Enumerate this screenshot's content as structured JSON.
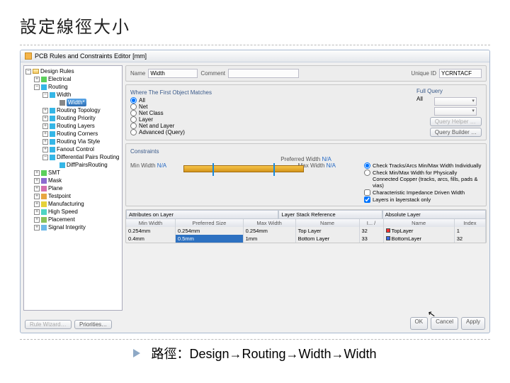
{
  "slide": {
    "title": "設定線徑大小",
    "caption_prefix": "路徑：",
    "caption_path": "Design→Routing→Width→Width"
  },
  "window": {
    "title": "PCB Rules and Constraints Editor [mm]"
  },
  "tree": {
    "root": "Design Rules",
    "items": [
      {
        "label": "Electrical",
        "indent": 12,
        "exp": "+",
        "icon": "electrical"
      },
      {
        "label": "Routing",
        "indent": 12,
        "exp": "−",
        "icon": "routing"
      },
      {
        "label": "Width",
        "indent": 24,
        "exp": "−",
        "icon": "width"
      },
      {
        "label": "Width*",
        "indent": 36,
        "selected": true
      },
      {
        "label": "Routing Topology",
        "indent": 24,
        "exp": "+",
        "icon": "routing"
      },
      {
        "label": "Routing Priority",
        "indent": 24,
        "exp": "+",
        "icon": "routing"
      },
      {
        "label": "Routing Layers",
        "indent": 24,
        "exp": "+",
        "icon": "routing"
      },
      {
        "label": "Routing Corners",
        "indent": 24,
        "exp": "+",
        "icon": "routing"
      },
      {
        "label": "Routing Via Style",
        "indent": 24,
        "exp": "+",
        "icon": "routing"
      },
      {
        "label": "Fanout Control",
        "indent": 24,
        "exp": "+",
        "icon": "routing"
      },
      {
        "label": "Differential Pairs Routing",
        "indent": 24,
        "exp": "−",
        "icon": "routing"
      },
      {
        "label": "DiffPairsRouting",
        "indent": 36,
        "icon": "leaf"
      },
      {
        "label": "SMT",
        "indent": 12,
        "exp": "+",
        "icon": "smt"
      },
      {
        "label": "Mask",
        "indent": 12,
        "exp": "+",
        "icon": "mask"
      },
      {
        "label": "Plane",
        "indent": 12,
        "exp": "+",
        "icon": "plane"
      },
      {
        "label": "Testpoint",
        "indent": 12,
        "exp": "+",
        "icon": "testpoint"
      },
      {
        "label": "Manufacturing",
        "indent": 12,
        "exp": "+",
        "icon": "mfg"
      },
      {
        "label": "High Speed",
        "indent": 12,
        "exp": "+",
        "icon": "hs"
      },
      {
        "label": "Placement",
        "indent": 12,
        "exp": "+",
        "icon": "placement"
      },
      {
        "label": "Signal Integrity",
        "indent": 12,
        "exp": "+",
        "icon": "si"
      }
    ],
    "icon_colors": {
      "electrical": "#5bd05b",
      "routing": "#35b6e6",
      "width": "#35b6e6",
      "smt": "#5bd05b",
      "mask": "#8d6ad0",
      "plane": "#d46fae",
      "testpoint": "#e8a640",
      "mfg": "#e6d23a",
      "hs": "#4fd4c3",
      "placement": "#89c25a",
      "si": "#6db9e8",
      "leaf": "#35b6e6"
    }
  },
  "header": {
    "name_label": "Name",
    "name_value": "Width",
    "comment_label": "Comment",
    "comment_value": "",
    "uid_label": "Unique ID",
    "uid_value": "YCRNTACF"
  },
  "matches": {
    "title": "Where The First Object Matches",
    "full_query_title": "Full Query",
    "full_query_value": "All",
    "radios": [
      "All",
      "Net",
      "Net Class",
      "Layer",
      "Net and Layer",
      "Advanced (Query)"
    ],
    "selected": 0,
    "helper_btn": "Query Helper …",
    "builder_btn": "Query Builder …"
  },
  "constraints": {
    "title": "Constraints",
    "preferred_label": "Preferred Width",
    "preferred_value": "N/A",
    "min_label": "Min Width",
    "min_value": "N/A",
    "max_label": "Max Width",
    "max_value": "N/A",
    "checks": [
      {
        "label": "Check Tracks/Arcs Min/Max Width Individually",
        "type": "radio",
        "checked": true
      },
      {
        "label": "Check Min/Max Width for Physically Connected Copper (tracks, arcs, fills, pads & vias)",
        "type": "radio",
        "checked": false
      },
      {
        "label": "Characteristic Impedance Driven Width",
        "type": "check",
        "checked": false
      },
      {
        "label": "Layers in layerstack only",
        "type": "check",
        "checked": true
      }
    ]
  },
  "grid": {
    "groups": [
      "Attributes on Layer",
      "Layer Stack Reference",
      "Absolute Layer"
    ],
    "headers": [
      "Min Width",
      "Preferred Size",
      "Max Width",
      "Name",
      "I... /",
      "Name",
      "Index"
    ],
    "rows": [
      {
        "min": "0.254mm",
        "pref": "0.254mm",
        "max": "0.254mm",
        "lname": "Top Layer",
        "idx": "32",
        "acolor": "#ff3030",
        "aname": "TopLayer",
        "aidx": "1"
      },
      {
        "min": "0.4mm",
        "pref": "0.5mm",
        "max": "1mm",
        "lname": "Bottom Layer",
        "idx": "33",
        "acolor": "#3a6ae8",
        "aname": "BottomLayer",
        "aidx": "32"
      }
    ],
    "selected_row": 1,
    "selected_col": "pref"
  },
  "footer": {
    "rule_wizard": "Rule Wizard…",
    "priorities": "Priorities…",
    "ok": "OK",
    "cancel": "Cancel",
    "apply": "Apply"
  }
}
